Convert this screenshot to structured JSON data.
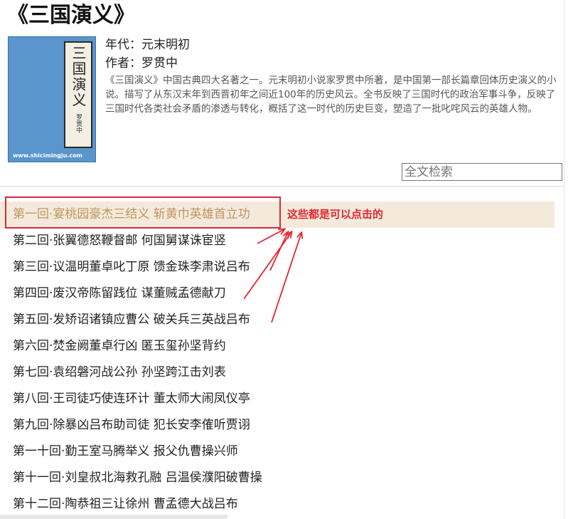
{
  "book": {
    "title": "《三国演义》",
    "era": "年代：元末明初",
    "author": "作者：罗贯中",
    "intro": "《三国演义》中国古典四大名著之一。元末明初小说家罗贯中所著，是中国第一部长篇章回体历史演义的小说。描写了从东汉末年到西晋初年之间近100年的历史风云。全书反映了三国时代的政治军事斗争，反映了三国时代各类社会矛盾的渗透与转化，概括了这一时代的历史巨变，塑造了一批叱咤风云的英雄人物。"
  },
  "cover": {
    "title_vertical": "三国演义",
    "subtitle_vertical": "罗贯中",
    "site": "www.shicimingju.com"
  },
  "search": {
    "placeholder": "全文检索"
  },
  "annotation": {
    "text": "这些都是可以点击的",
    "color": "#e5262f"
  },
  "chapters": [
    "第一回·宴桃园豪杰三结义 斩黄巾英雄首立功",
    "第二回·张翼德怒鞭督邮 何国舅谋诛宦竖",
    "第三回·议温明董卓叱丁原 馈金珠李肃说吕布",
    "第四回·废汉帝陈留践位 谋董贼孟德献刀",
    "第五回·发矫诏诸镇应曹公 破关兵三英战吕布",
    "第六回·焚金阙董卓行凶 匿玉玺孙坚背约",
    "第七回·袁绍磐河战公孙 孙坚跨江击刘表",
    "第八回·王司徒巧使连环计 董太师大闹凤仪亭",
    "第九回·除暴凶吕布助司徒 犯长安李傕听贾诩",
    "第一十回·勤王室马腾举义 报父仇曹操兴师",
    "第十一回·刘皇叔北海救孔融 吕温侯濮阳破曹操",
    "第十二回·陶恭祖三让徐州 曹孟德大战吕布"
  ],
  "colors": {
    "active_bg": "#f4eadc",
    "active_text": "#c09560",
    "highlight_border": "#d9293b"
  }
}
